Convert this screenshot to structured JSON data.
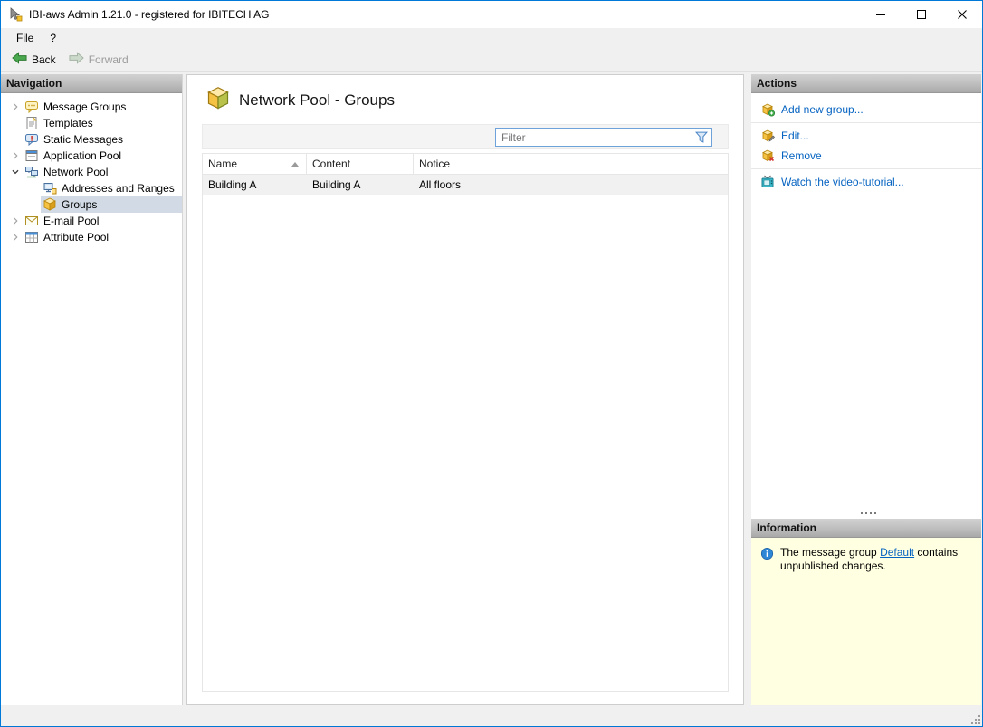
{
  "window": {
    "title": "IBI-aws Admin 1.21.0 - registered for IBITECH AG"
  },
  "menu": {
    "items": [
      {
        "label": "File"
      },
      {
        "label": "?"
      }
    ]
  },
  "toolbar": {
    "back_label": "Back",
    "forward_label": "Forward",
    "forward_enabled": false
  },
  "navigation": {
    "header": "Navigation",
    "items": [
      {
        "label": "Message Groups",
        "icon": "message-groups-icon",
        "expander": "collapsed",
        "level": 0,
        "selected": false
      },
      {
        "label": "Templates",
        "icon": "templates-icon",
        "expander": "none",
        "level": 0,
        "selected": false
      },
      {
        "label": "Static Messages",
        "icon": "static-messages-icon",
        "expander": "none",
        "level": 0,
        "selected": false
      },
      {
        "label": "Application Pool",
        "icon": "application-pool-icon",
        "expander": "collapsed",
        "level": 0,
        "selected": false
      },
      {
        "label": "Network Pool",
        "icon": "network-pool-icon",
        "expander": "expanded",
        "level": 0,
        "selected": false
      },
      {
        "label": "Addresses and Ranges",
        "icon": "addresses-icon",
        "expander": "none",
        "level": 1,
        "selected": false
      },
      {
        "label": "Groups",
        "icon": "group-box-icon",
        "expander": "none",
        "level": 1,
        "selected": true
      },
      {
        "label": "E-mail Pool",
        "icon": "email-pool-icon",
        "expander": "collapsed",
        "level": 0,
        "selected": false
      },
      {
        "label": "Attribute Pool",
        "icon": "attribute-pool-icon",
        "expander": "collapsed",
        "level": 0,
        "selected": false
      }
    ]
  },
  "main": {
    "title": "Network Pool - Groups",
    "title_icon": "group-box-icon",
    "filter": {
      "placeholder": "Filter",
      "value": ""
    },
    "table": {
      "columns": [
        {
          "label": "Name"
        },
        {
          "label": "Content"
        },
        {
          "label": "Notice"
        }
      ],
      "sort": {
        "column": "Name",
        "direction": "ascending"
      },
      "rows": [
        {
          "name": "Building A",
          "content": "Building A",
          "notice": "All floors"
        }
      ]
    }
  },
  "actions": {
    "header": "Actions",
    "items": [
      {
        "label": "Add new group...",
        "icon": "add-group-icon"
      },
      {
        "label": "Edit...",
        "icon": "edit-group-icon"
      },
      {
        "label": "Remove",
        "icon": "remove-group-icon"
      },
      {
        "label": "Watch the video-tutorial...",
        "icon": "video-tutorial-icon"
      }
    ]
  },
  "information": {
    "header": "Information",
    "message": {
      "before": "The message group ",
      "link": "Default",
      "after": " contains unpublished changes."
    }
  },
  "colors": {
    "window_border": "#0078d7",
    "link": "#0563c1",
    "info_background": "#ffffe1",
    "tree_selection": "#d2dbe5",
    "pane_header_gradient_top": "#d2d2d2",
    "pane_header_gradient_bottom": "#a9a9a9"
  }
}
